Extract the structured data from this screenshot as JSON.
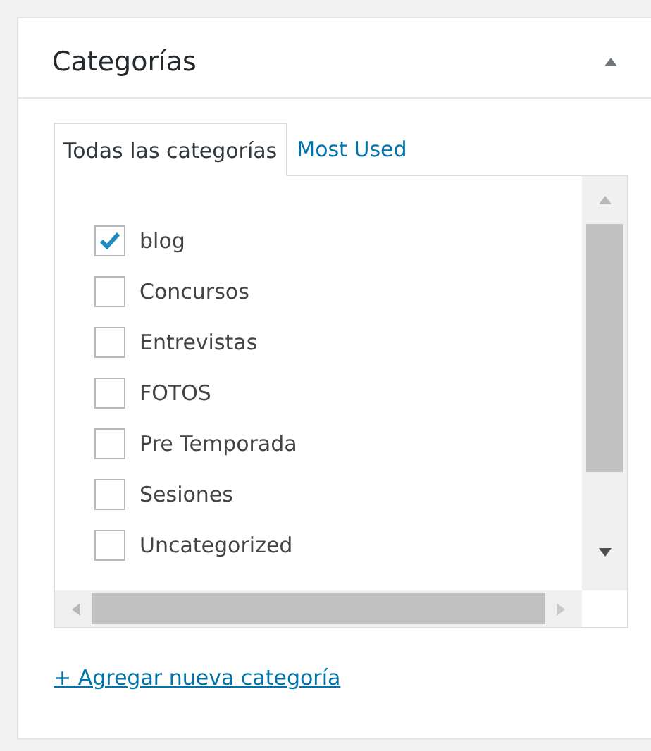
{
  "panel": {
    "title": "Categorías",
    "collapsed": false
  },
  "tabs": [
    {
      "label": "Todas las categorías",
      "selected": true
    },
    {
      "label": "Most Used",
      "selected": false
    }
  ],
  "categories": [
    {
      "name": "blog",
      "checked": true
    },
    {
      "name": "Concursos",
      "checked": false
    },
    {
      "name": "Entrevistas",
      "checked": false
    },
    {
      "name": "FOTOS",
      "checked": false
    },
    {
      "name": "Pre Temporada",
      "checked": false
    },
    {
      "name": "Sesiones",
      "checked": false
    },
    {
      "name": "Uncategorized",
      "checked": false
    }
  ],
  "add_link": "+ Agregar nueva categoría"
}
